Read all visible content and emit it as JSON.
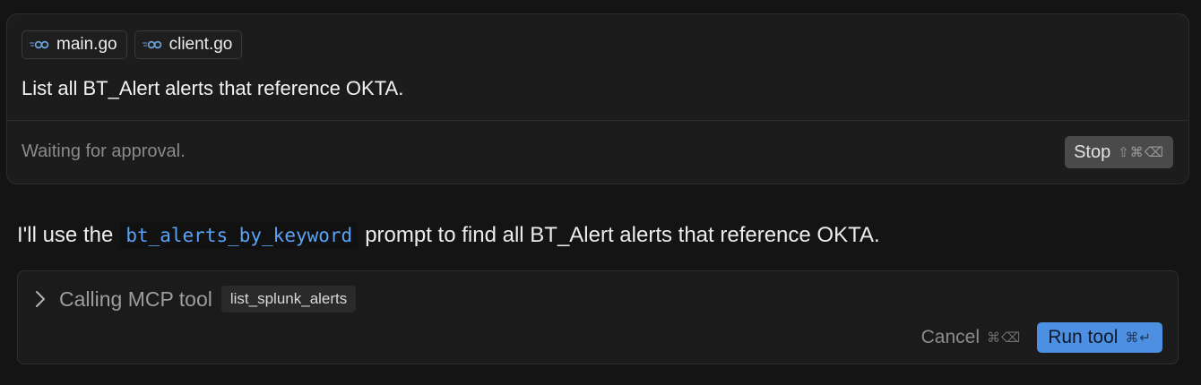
{
  "composer": {
    "attachments": [
      {
        "label": "main.go",
        "icon": "go-file-icon"
      },
      {
        "label": "client.go",
        "icon": "go-file-icon"
      }
    ],
    "prompt": "List all BT_Alert alerts that reference OKTA.",
    "status": "Waiting for approval.",
    "stop_button": {
      "label": "Stop",
      "shortcut": "⇧⌘⌫"
    }
  },
  "assistant": {
    "text_before": "I'll use the",
    "code": "bt_alerts_by_keyword",
    "text_after": "prompt to find all BT_Alert alerts that reference OKTA."
  },
  "tool_call": {
    "label": "Calling MCP tool",
    "tool_name": "list_splunk_alerts",
    "cancel": {
      "label": "Cancel",
      "shortcut": "⌘⌫"
    },
    "run": {
      "label": "Run tool",
      "shortcut": "⌘↵"
    }
  },
  "colors": {
    "background": "#141414",
    "accent": "#4d8fe0",
    "code_text": "#5aa2f5"
  }
}
